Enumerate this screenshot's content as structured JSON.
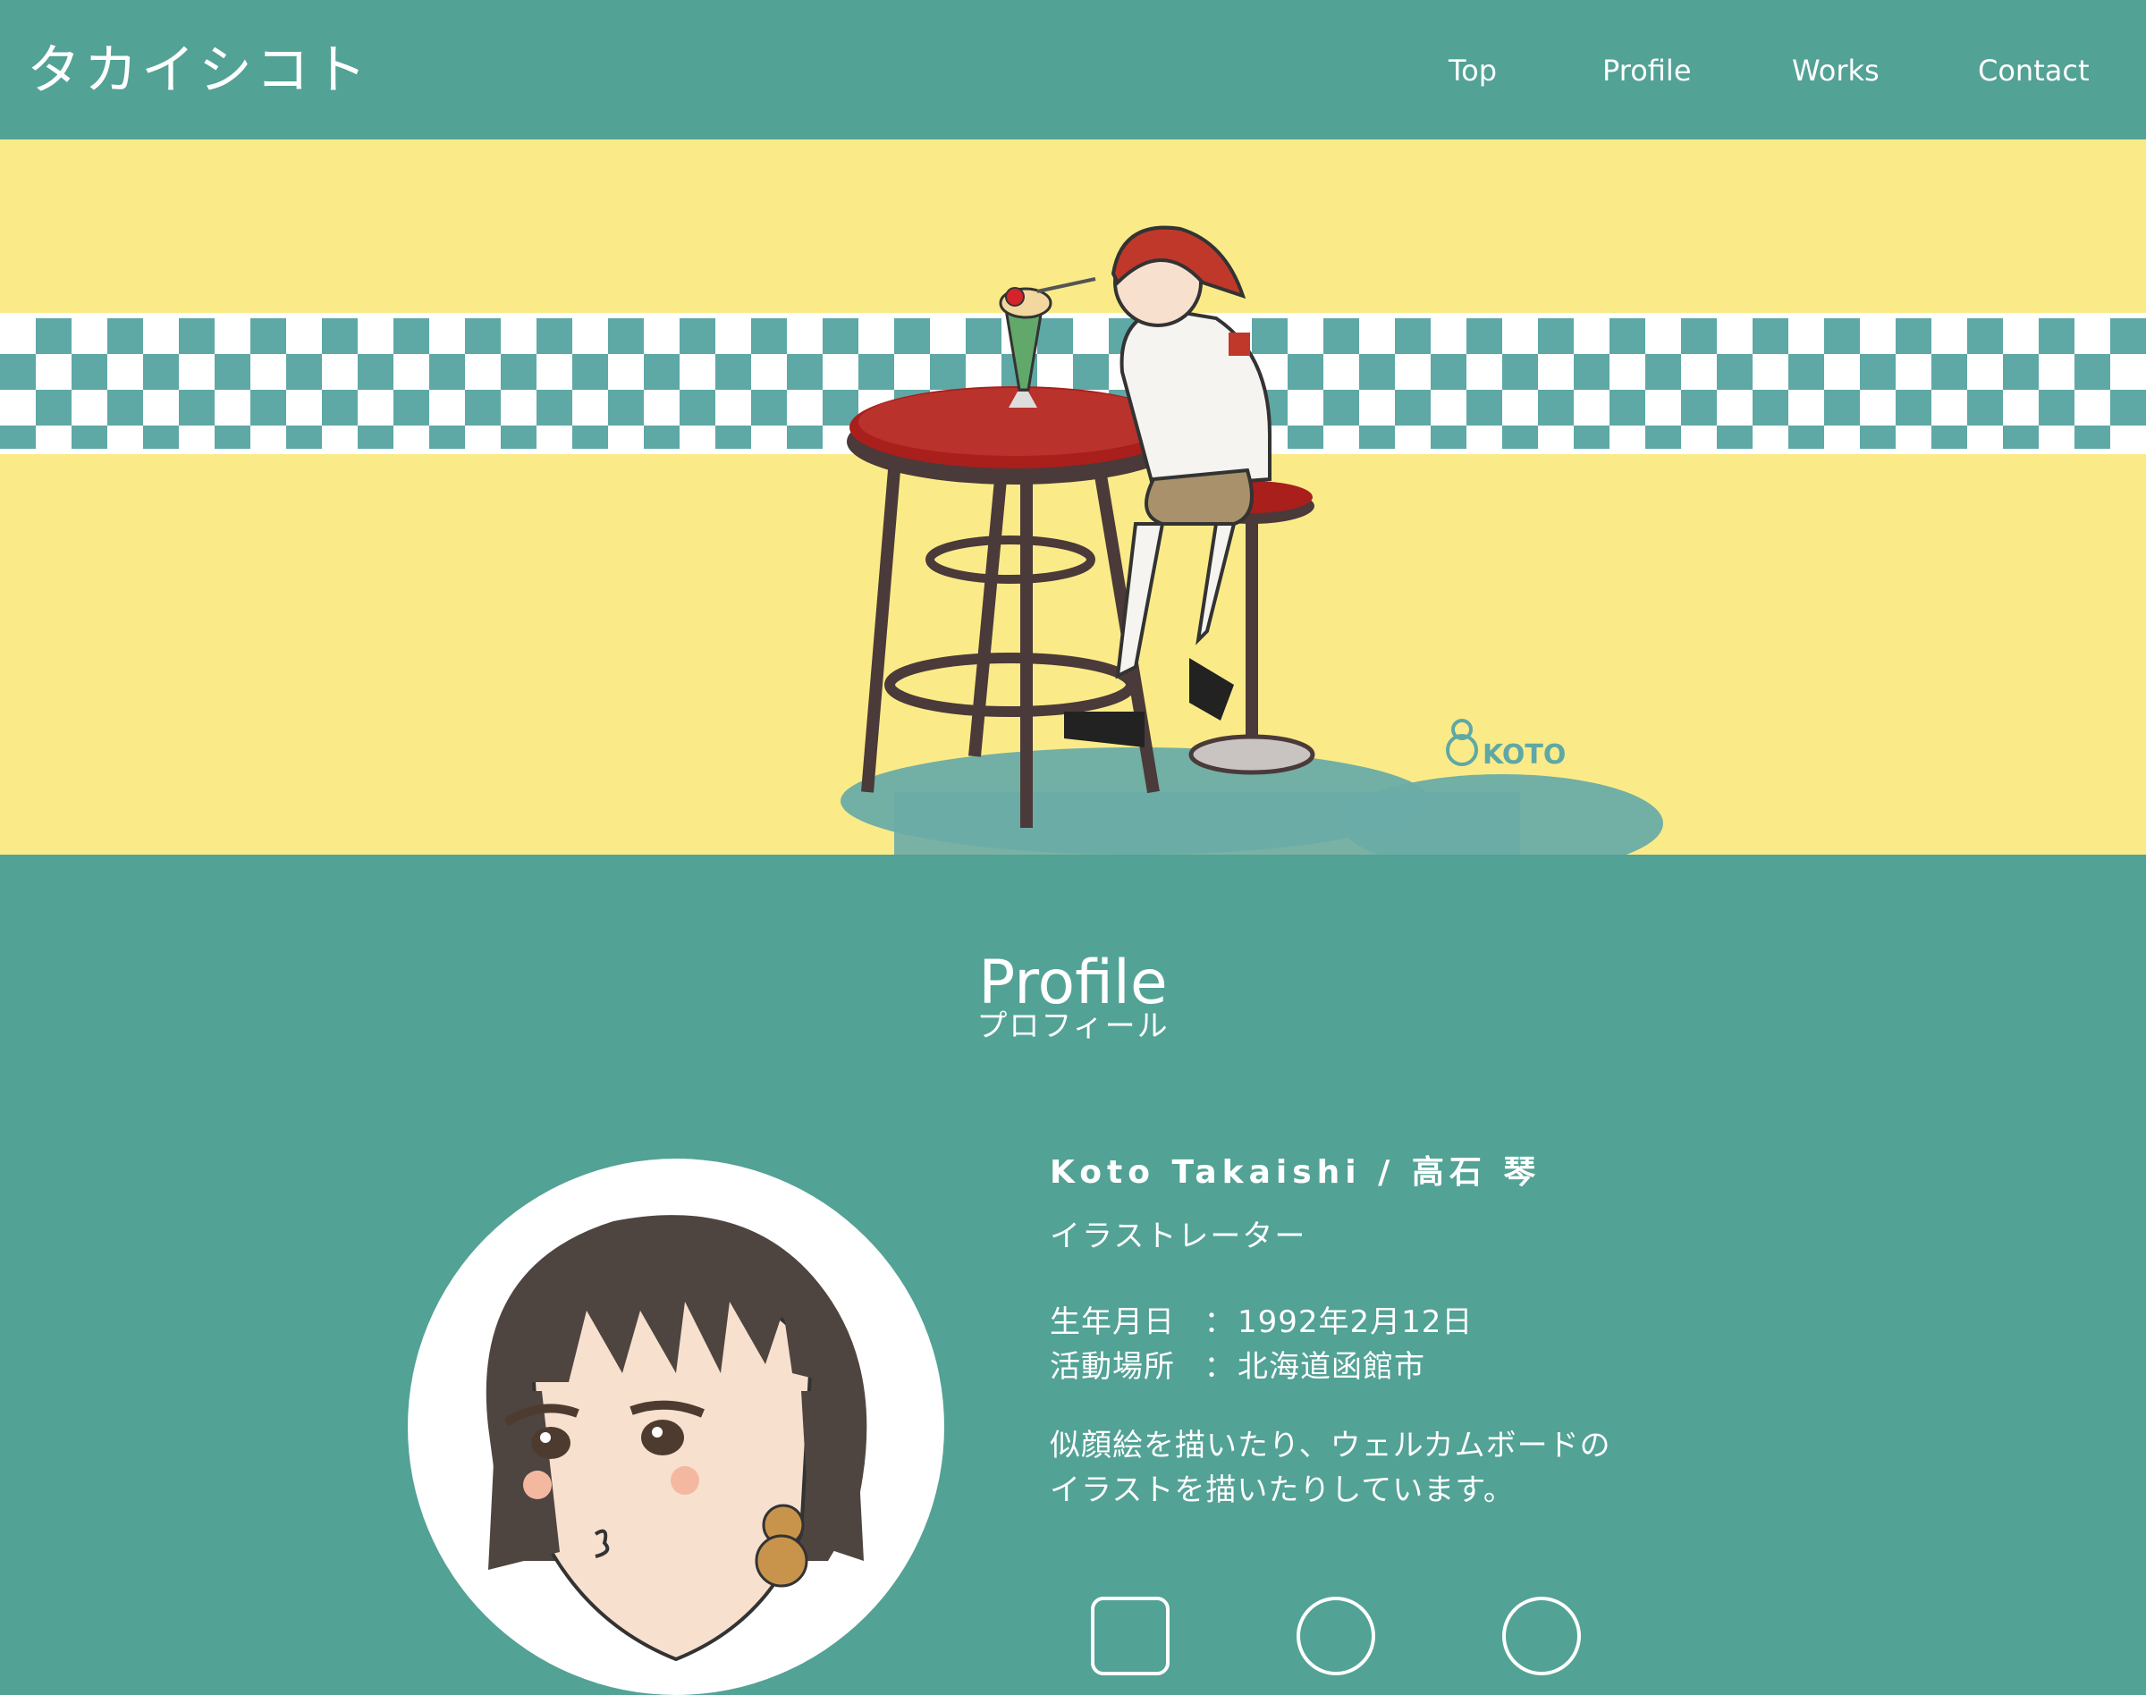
{
  "site": {
    "title": "タカイシコト"
  },
  "nav": {
    "items": [
      {
        "label": "Top"
      },
      {
        "label": "Profile"
      },
      {
        "label": "Works"
      },
      {
        "label": "Contact"
      }
    ]
  },
  "hero": {
    "signature": "KOTO"
  },
  "profile": {
    "heading": "Profile",
    "heading_ja": "プロフィール",
    "name": "Koto Takaishi / 高石 琴",
    "job": "イラストレーター",
    "facts": [
      {
        "label": "生年月日",
        "sep": "：",
        "value": "1992年2月12日"
      },
      {
        "label": "活動場所",
        "sep": "：",
        "value": "北海道函館市"
      }
    ],
    "bio_lines": [
      "似顔絵を描いたり、ウェルカムボードの",
      "イラストを描いたりしています。"
    ]
  },
  "colors": {
    "teal": "#52a295",
    "yellow": "#fbeb88",
    "checker_teal": "#5ea8a6",
    "table_red": "#a81f1c",
    "white": "#ffffff"
  }
}
